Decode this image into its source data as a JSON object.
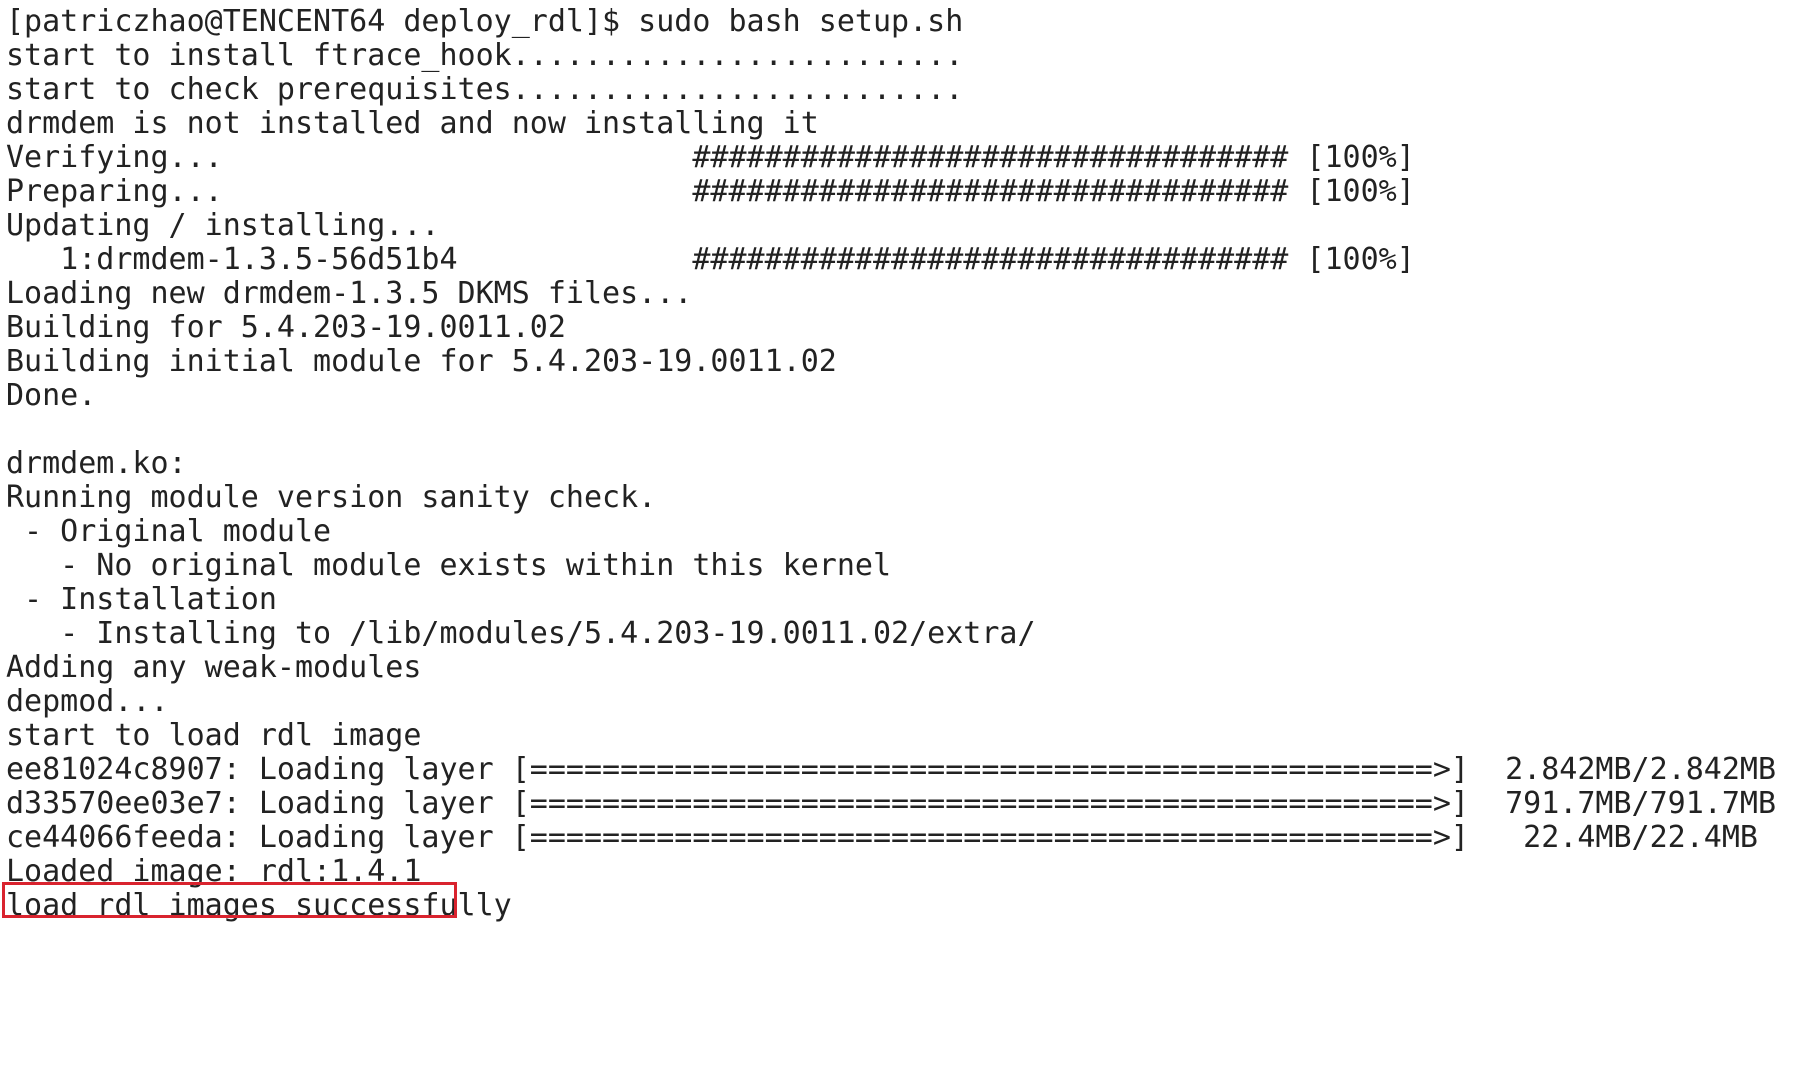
{
  "terminal": {
    "lines": [
      "[patriczhao@TENCENT64 deploy_rdl]$ sudo bash setup.sh",
      "start to install ftrace_hook.........................",
      "start to check prerequisites.........................",
      "drmdem is not installed and now installing it",
      "Verifying...                          ################################# [100%]",
      "Preparing...                          ################################# [100%]",
      "Updating / installing...",
      "   1:drmdem-1.3.5-56d51b4             ################################# [100%]",
      "Loading new drmdem-1.3.5 DKMS files...",
      "Building for 5.4.203-19.0011.02",
      "Building initial module for 5.4.203-19.0011.02",
      "Done.",
      "",
      "drmdem.ko:",
      "Running module version sanity check.",
      " - Original module",
      "   - No original module exists within this kernel",
      " - Installation",
      "   - Installing to /lib/modules/5.4.203-19.0011.02/extra/",
      "Adding any weak-modules",
      "depmod...",
      "start to load rdl image",
      "ee81024c8907: Loading layer [==================================================>]  2.842MB/2.842MB",
      "d33570ee03e7: Loading layer [==================================================>]  791.7MB/791.7MB",
      "ce44066feeda: Loading layer [==================================================>]   22.4MB/22.4MB",
      "Loaded image: rdl:1.4.1",
      "load rdl images successfully"
    ]
  },
  "highlight": {
    "color": "#d9232e",
    "target_line": "load rdl images successfully"
  },
  "colors": {
    "background": "#ffffff",
    "text": "#222222"
  }
}
